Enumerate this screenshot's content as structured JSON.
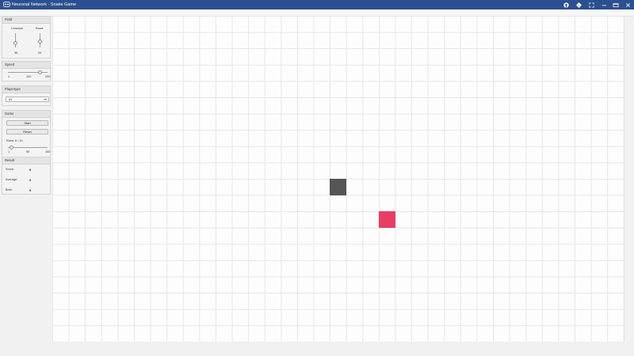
{
  "window": {
    "title": "Neuronal Network - Snake Game",
    "controls": [
      "github-icon",
      "diamond-icon",
      "fullscreen-icon",
      "minimize-icon",
      "restore-icon",
      "close-icon"
    ]
  },
  "field": {
    "header": "Field",
    "columns_label": "Columns",
    "rows_label": "Rows",
    "columns_value": "35",
    "rows_value": "20"
  },
  "speed": {
    "header": "Speed",
    "min": "1",
    "mid": "100",
    "max": "200",
    "level": 0.8
  },
  "playertype": {
    "header": "Playertype",
    "selected": "AI"
  },
  "game": {
    "header": "Game",
    "start_label": "Start",
    "reset_label": "Reset",
    "runs_label": "Runs: 0 / 10",
    "min": "1",
    "mid": "50",
    "max": "100",
    "level": 0.09
  },
  "result": {
    "header": "Result",
    "score_label": "Score:",
    "score_value": "0",
    "average_label": "Average:",
    "average_value": "0",
    "best_label": "Best:",
    "best_value": "0"
  },
  "board": {
    "columns": 35,
    "rows": 20,
    "snake_head": {
      "col": 17,
      "row": 10,
      "color": "#555555"
    },
    "food": {
      "col": 20,
      "row": 12,
      "color": "#e83e64"
    }
  },
  "colors": {
    "titlebar": "#2c4f8f",
    "grid_line": "#e6e6e6"
  }
}
